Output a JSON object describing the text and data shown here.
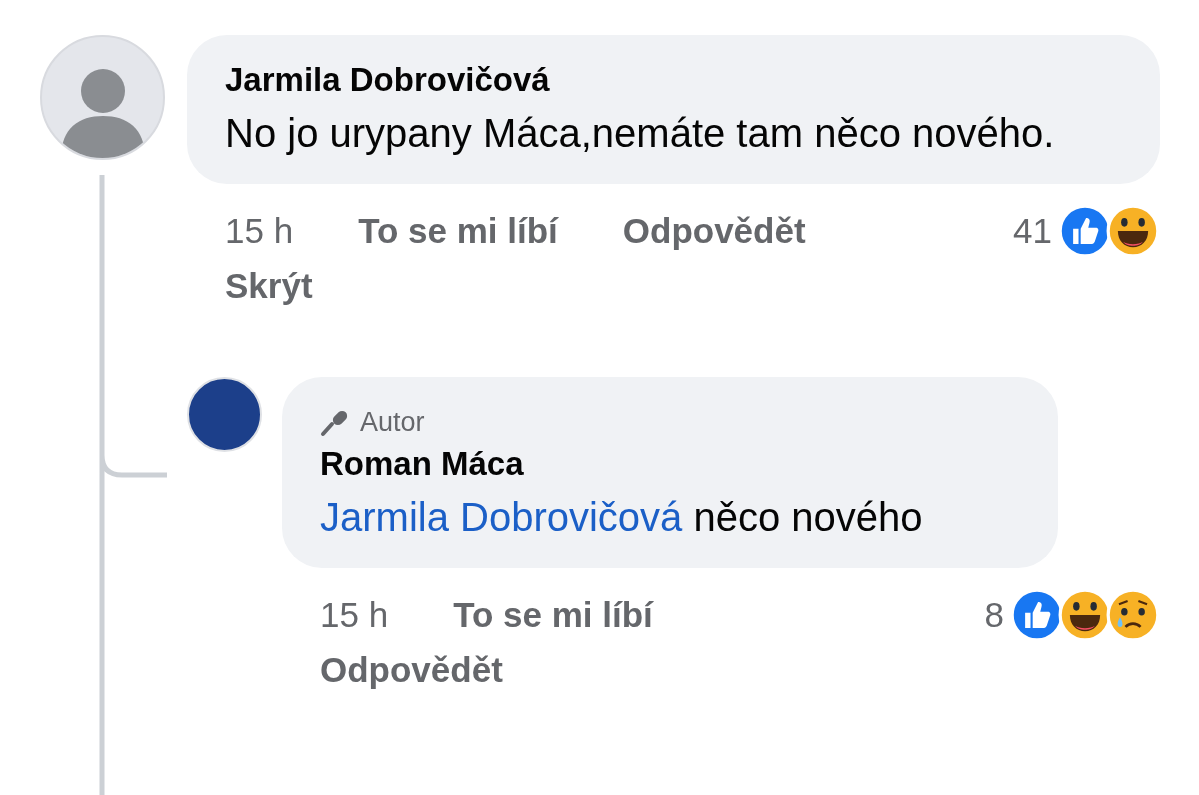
{
  "comments": [
    {
      "avatar": {
        "kind": "silhouette"
      },
      "author": "Jarmila Dobrovičová",
      "text": "No jo urypany Máca,nemáte tam něco nového.",
      "time": "15 h",
      "actions": [
        "To se mi líbí",
        "Odpovědět"
      ],
      "second_line_action": "Skrýt",
      "reaction_count": "41",
      "reactions": [
        {
          "kind": "like"
        },
        {
          "kind": "haha"
        }
      ]
    },
    {
      "avatar": {
        "kind": "photo"
      },
      "badge": "Autor",
      "author": "Roman Máca",
      "mention": "Jarmila Dobrovičová",
      "text": "něco nového",
      "time": "15 h",
      "actions": [
        "To se mi líbí"
      ],
      "second_line_action": "Odpovědět",
      "reaction_count": "8",
      "reactions": [
        {
          "kind": "like"
        },
        {
          "kind": "haha"
        },
        {
          "kind": "sad"
        }
      ]
    }
  ]
}
